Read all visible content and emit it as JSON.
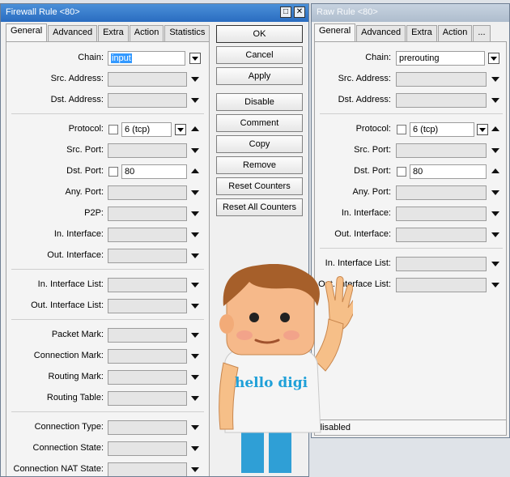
{
  "firewall": {
    "title": "Firewall Rule <80>",
    "tabs": [
      "General",
      "Advanced",
      "Extra",
      "Action",
      "Statistics"
    ],
    "fields": {
      "chain": {
        "label": "Chain:",
        "value": "input"
      },
      "src_address": {
        "label": "Src. Address:"
      },
      "dst_address": {
        "label": "Dst. Address:"
      },
      "protocol": {
        "label": "Protocol:",
        "value": "6 (tcp)"
      },
      "src_port": {
        "label": "Src. Port:"
      },
      "dst_port": {
        "label": "Dst. Port:",
        "value": "80"
      },
      "any_port": {
        "label": "Any. Port:"
      },
      "p2p": {
        "label": "P2P:"
      },
      "in_interface": {
        "label": "In. Interface:"
      },
      "out_interface": {
        "label": "Out. Interface:"
      },
      "in_interface_list": {
        "label": "In. Interface List:"
      },
      "out_interface_list": {
        "label": "Out. Interface List:"
      },
      "packet_mark": {
        "label": "Packet Mark:"
      },
      "connection_mark": {
        "label": "Connection Mark:"
      },
      "routing_mark": {
        "label": "Routing Mark:"
      },
      "routing_table": {
        "label": "Routing Table:"
      },
      "connection_type": {
        "label": "Connection Type:"
      },
      "connection_state": {
        "label": "Connection State:"
      },
      "connection_nat_state": {
        "label": "Connection NAT State:"
      }
    },
    "buttons": {
      "ok": "OK",
      "cancel": "Cancel",
      "apply": "Apply",
      "disable": "Disable",
      "comment": "Comment",
      "copy": "Copy",
      "remove": "Remove",
      "reset_counters": "Reset Counters",
      "reset_all_counters": "Reset All Counters"
    }
  },
  "raw": {
    "title": "Raw Rule <80>",
    "tabs": [
      "General",
      "Advanced",
      "Extra",
      "Action",
      "..."
    ],
    "fields": {
      "chain": {
        "label": "Chain:",
        "value": "prerouting"
      },
      "src_address": {
        "label": "Src. Address:"
      },
      "dst_address": {
        "label": "Dst. Address:"
      },
      "protocol": {
        "label": "Protocol:",
        "value": "6 (tcp)"
      },
      "src_port": {
        "label": "Src. Port:"
      },
      "dst_port": {
        "label": "Dst. Port:",
        "value": "80"
      },
      "any_port": {
        "label": "Any. Port:"
      },
      "in_interface": {
        "label": "In. Interface:"
      },
      "out_interface": {
        "label": "Out. Interface:"
      },
      "in_interface_list": {
        "label": "In. Interface List:"
      },
      "out_interface_list": {
        "label": "Out. Interface List:"
      }
    },
    "status": "disabled"
  },
  "mascot": {
    "shirt_text": "hello digi"
  },
  "colors": {
    "titlebar_active": "#3a80d0",
    "titlebar_inactive": "#b9c7d6",
    "selection": "#3399ff",
    "mascot_text": "#1fa0d8"
  }
}
